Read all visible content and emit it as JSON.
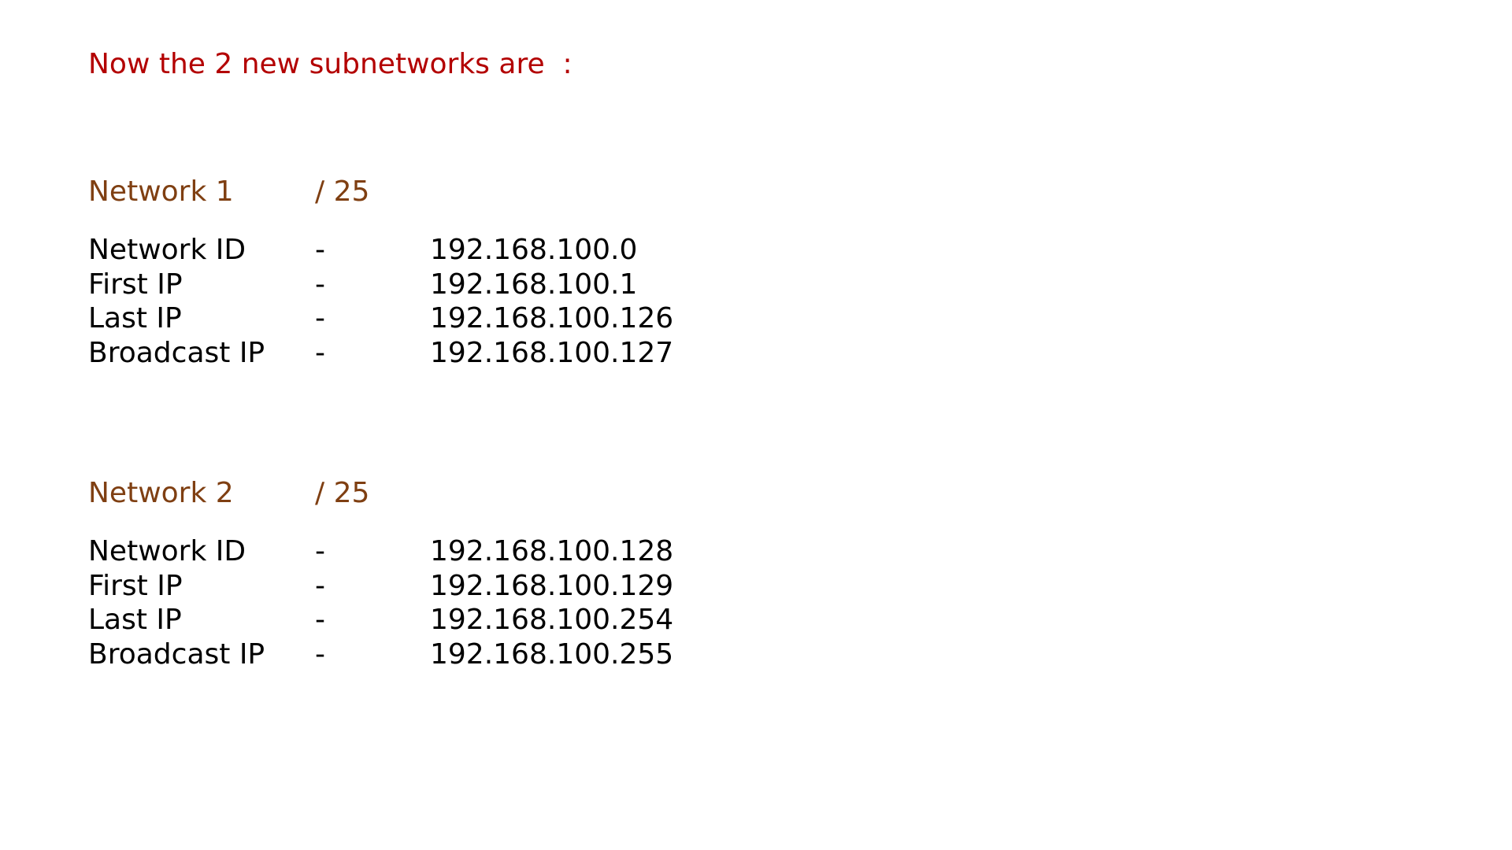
{
  "heading": "Now the 2 new subnetworks are  :",
  "networks": [
    {
      "name": "Network 1",
      "prefix": "/ 25",
      "rows": [
        {
          "label": "Network ID",
          "dash": "-",
          "value": "192.168.100.0"
        },
        {
          "label": "First IP",
          "dash": "-",
          "value": "192.168.100.1"
        },
        {
          "label": "Last IP",
          "dash": "-",
          "value": "192.168.100.126"
        },
        {
          "label": "Broadcast IP",
          "dash": "-",
          "value": "192.168.100.127"
        }
      ]
    },
    {
      "name": "Network 2",
      "prefix": "/ 25",
      "rows": [
        {
          "label": "Network ID",
          "dash": "-",
          "value": "192.168.100.128"
        },
        {
          "label": "First IP",
          "dash": "-",
          "value": "192.168.100.129"
        },
        {
          "label": "Last IP",
          "dash": "-",
          "value": "192.168.100.254"
        },
        {
          "label": "Broadcast IP",
          "dash": "-",
          "value": "192.168.100.255"
        }
      ]
    }
  ],
  "colors": {
    "heading": "#b30000",
    "network_title": "#7f3f12",
    "body_text": "#000000",
    "background": "#ffffff"
  }
}
